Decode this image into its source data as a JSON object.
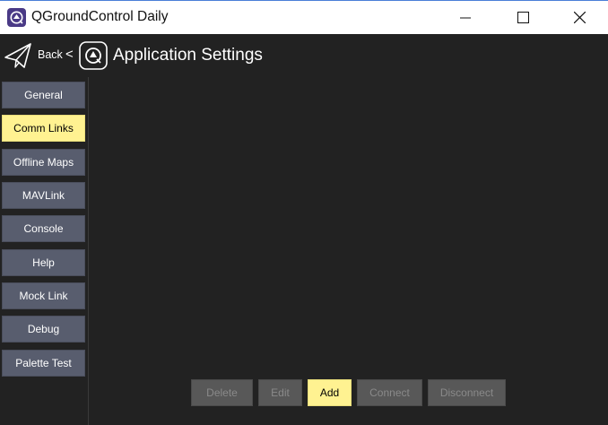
{
  "window": {
    "title": "QGroundControl Daily"
  },
  "toolbar": {
    "back_label": "Back",
    "separator": "<",
    "page_title": "Application Settings"
  },
  "sidebar": {
    "items": [
      {
        "label": "General"
      },
      {
        "label": "Comm Links"
      },
      {
        "label": "Offline Maps"
      },
      {
        "label": "MAVLink"
      },
      {
        "label": "Console"
      },
      {
        "label": "Help"
      },
      {
        "label": "Mock Link"
      },
      {
        "label": "Debug"
      },
      {
        "label": "Palette Test"
      }
    ],
    "active": "Comm Links"
  },
  "actions": {
    "delete": "Delete",
    "edit": "Edit",
    "add": "Add",
    "connect": "Connect",
    "disconnect": "Disconnect"
  },
  "colors": {
    "background": "#222222",
    "button": "#585d6e",
    "highlight": "#fff291",
    "disabled_button": "#585858"
  }
}
